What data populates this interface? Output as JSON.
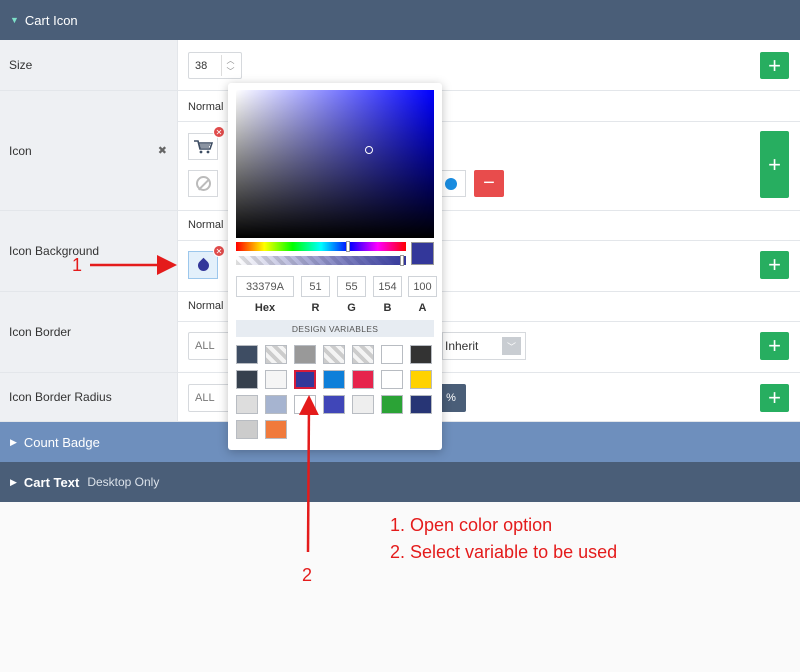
{
  "cart_icon_header": "Cart Icon",
  "rows": {
    "size": {
      "label": "Size",
      "value": "38"
    },
    "icon": {
      "label": "Icon",
      "normal": "Normal"
    },
    "icon_background": {
      "label": "Icon Background",
      "normal": "Normal"
    },
    "icon_border": {
      "label": "Icon Border",
      "normal": "Normal",
      "all": "ALL",
      "select_value": "Inherit"
    },
    "icon_border_radius": {
      "label": "Icon Border Radius",
      "all": "ALL",
      "unit": "%"
    }
  },
  "add_label": "+",
  "remove_label": "−",
  "clear_label": "✖",
  "count_badge_header": "Count Badge",
  "cart_text_header": "Cart Text",
  "cart_text_sub": "Desktop Only",
  "picker": {
    "hex": "33379A",
    "r": "51",
    "g": "55",
    "b": "154",
    "a": "100",
    "labels": {
      "hex": "Hex",
      "r": "R",
      "g": "G",
      "b": "B",
      "a": "A"
    },
    "design_variables_label": "DESIGN VARIABLES",
    "swatches": [
      "#3e4d63",
      "checker",
      "#999999",
      "checker",
      "checker",
      "#ffffff",
      "#333333",
      "#36404d",
      "#f5f5f5",
      "#33379a",
      "#0e7fd9",
      "#e6244c",
      "#ffffff",
      "#ffd200",
      "#dddddd",
      "#a6b4d0",
      "#ffffff",
      "#4046b8",
      "#eeeeee",
      "#2ba336",
      "#273575",
      "#cccccc",
      "#f07a3c"
    ],
    "selected_index": 9
  },
  "annotations": {
    "marker1": "1",
    "marker2": "2",
    "step1": "1. Open color option",
    "step2": "2. Select variable to be used"
  }
}
